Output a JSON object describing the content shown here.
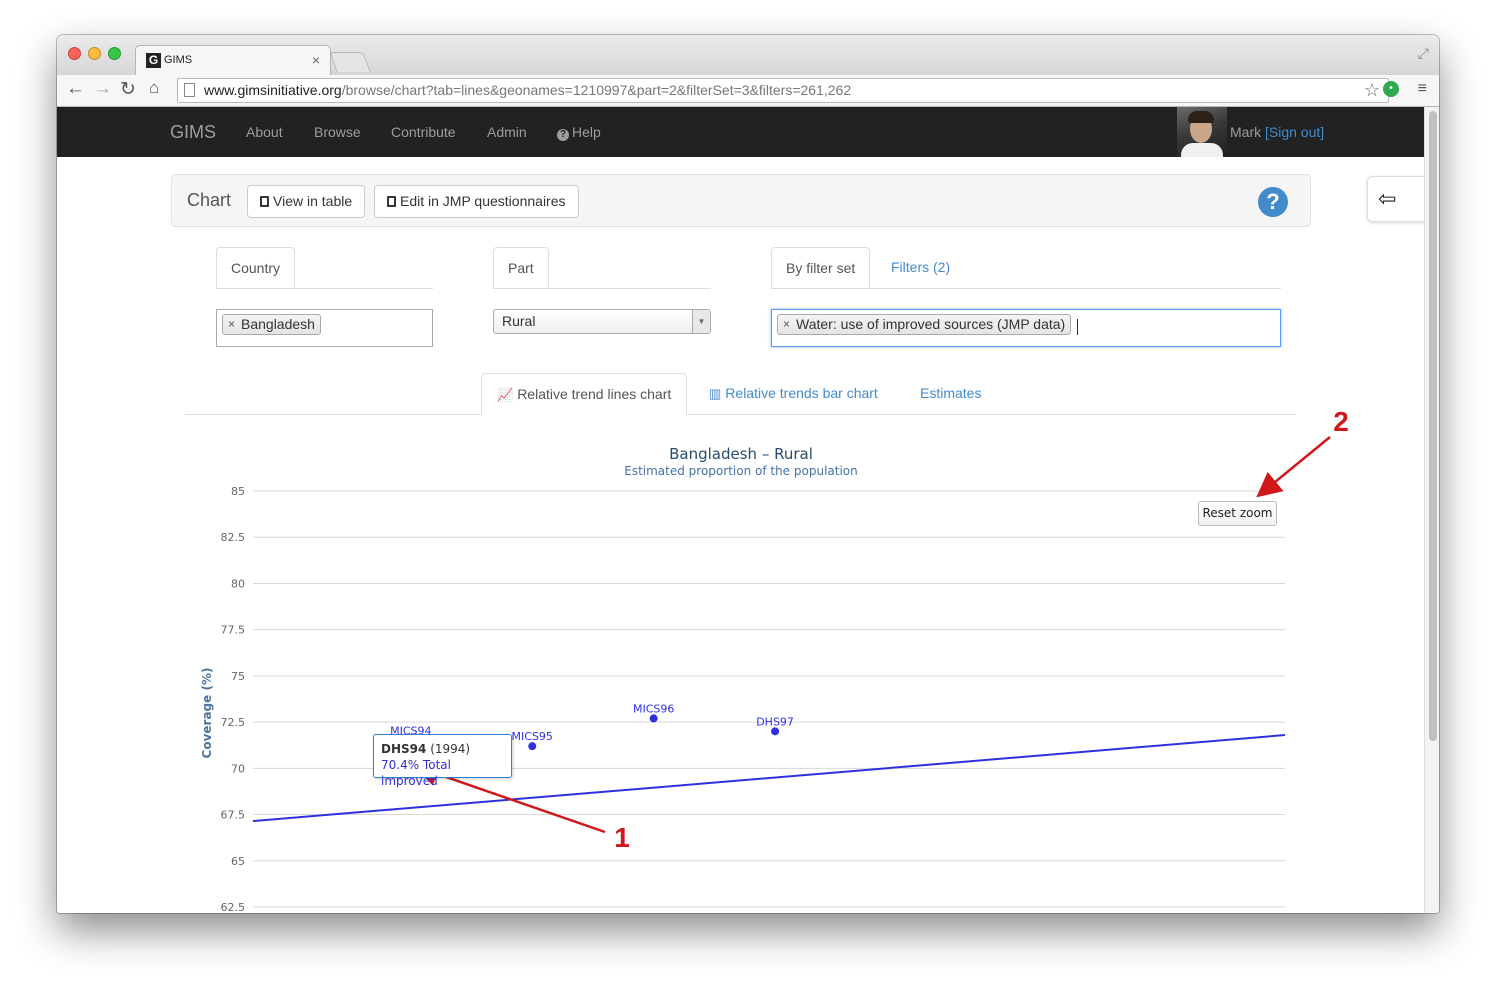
{
  "browser": {
    "tab_title": "GIMS",
    "tab_favicon": "G",
    "url_host": "www.gimsinitiative.org",
    "url_path": "/browse/chart?tab=lines&geonames=1210997&part=2&filterSet=3&filters=261,262",
    "nav_icons": [
      "back-arrow-icon",
      "forward-arrow-icon",
      "reload-icon",
      "home-icon"
    ]
  },
  "navbar": {
    "brand": "GIMS",
    "links": [
      "About",
      "Browse",
      "Contribute",
      "Admin",
      "Help"
    ],
    "user_name": "Mark",
    "signout_label": "[Sign out]"
  },
  "panel": {
    "title": "Chart",
    "view_table_label": "View in table",
    "edit_jmp_label": "Edit in JMP questionnaires",
    "help_symbol": "?"
  },
  "filters": {
    "country_tab": "Country",
    "country_value": "Bangladesh",
    "part_tab": "Part",
    "part_value": "Rural",
    "filterset_tab": "By filter set",
    "filters_tab": "Filters (2)",
    "filterset_value": "Water: use of improved sources (JMP data)"
  },
  "chart_tabs": {
    "lines": "Relative trend lines chart",
    "bars": "Relative trends bar chart",
    "estimates": "Estimates"
  },
  "chart_data": {
    "type": "scatter",
    "title": "Bangladesh – Rural",
    "subtitle": "Estimated proportion of the population",
    "xlabel": "",
    "ylabel": "Coverage (%)",
    "ylim": [
      62.5,
      85
    ],
    "yticks": [
      "62.5",
      "65",
      "67.5",
      "70",
      "72.5",
      "75",
      "77.5",
      "80",
      "82.5",
      "85"
    ],
    "xlim": [
      1992.7,
      2001.2
    ],
    "grid": true,
    "points": [
      {
        "label": "MICS94",
        "x": 1994.0,
        "y": 71.5
      },
      {
        "label": "DHS94",
        "x": 1994.0,
        "y": 70.4
      },
      {
        "label": "MICS95",
        "x": 1995.0,
        "y": 71.2
      },
      {
        "label": "MICS96",
        "x": 1996.0,
        "y": 72.7
      },
      {
        "label": "DHS97",
        "x": 1997.0,
        "y": 72.0
      }
    ],
    "trend": {
      "x": [
        1992.7,
        2001.2
      ],
      "y": [
        67.15,
        71.8
      ]
    },
    "series_color": "#2f2fe0"
  },
  "tooltip": {
    "survey": "DHS94",
    "year": "(1994)",
    "value": "70.4% Total improved"
  },
  "reset_zoom_label": "Reset zoom",
  "annotations": {
    "marker_1": "1",
    "marker_2": "2",
    "color": "#d0181b"
  }
}
